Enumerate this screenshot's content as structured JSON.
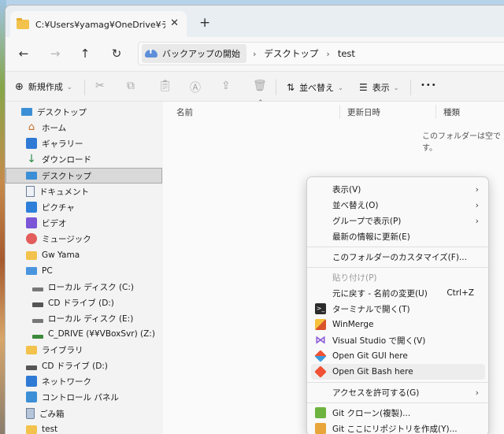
{
  "tab": {
    "title": "C:¥Users¥yamag¥OneDrive¥デスクトップ",
    "close": "✕",
    "new": "+"
  },
  "nav": {
    "back": "←",
    "forward": "→",
    "up": "↑",
    "refresh": "↻"
  },
  "address": {
    "home": "バックアップの開始",
    "sep": "›",
    "crumbs": [
      "デスクトップ",
      "test"
    ]
  },
  "commands": {
    "new": "新規作成",
    "sort": "並べ替え",
    "view": "表示",
    "more": "•••"
  },
  "sidebar": {
    "items": [
      "デスクトップ",
      "ホーム",
      "ギャラリー",
      "ダウンロード",
      "デスクトップ",
      "ドキュメント",
      "ピクチャ",
      "ビデオ",
      "ミュージック",
      "Gw Yama",
      "PC",
      "ローカル ディスク (C:)",
      "CD ドライブ (D:)",
      "ローカル ディスク (E:)",
      "C_DRIVE (¥¥VBoxSvr) (Z:)",
      "ライブラリ",
      "CD ドライブ (D:)",
      "ネットワーク",
      "コントロール パネル",
      "ごみ箱",
      "test"
    ]
  },
  "columns": {
    "name": "名前",
    "modified": "更新日時",
    "type": "種類"
  },
  "empty_message": "このフォルダーは空です。",
  "context_menu": {
    "items": [
      {
        "label": "表示(V)",
        "sub": "›"
      },
      {
        "label": "並べ替え(O)",
        "sub": "›"
      },
      {
        "label": "グループで表示(P)",
        "sub": "›"
      },
      {
        "label": "最新の情報に更新(E)"
      },
      {
        "label": "このフォルダーのカスタマイズ(F)..."
      },
      {
        "label": "貼り付け(P)"
      },
      {
        "label": "元に戻す - 名前の変更(U)",
        "accel": "Ctrl+Z"
      },
      {
        "label": "ターミナルで開く(T)"
      },
      {
        "label": "WinMerge"
      },
      {
        "label": "Visual Studio で開く(V)"
      },
      {
        "label": "Open Git GUI here"
      },
      {
        "label": "Open Git Bash here"
      },
      {
        "label": "アクセスを許可する(G)",
        "sub": "›"
      },
      {
        "label": "Git クローン(複製)..."
      },
      {
        "label": "Git ここにリポジトリを作成(Y)..."
      }
    ]
  }
}
